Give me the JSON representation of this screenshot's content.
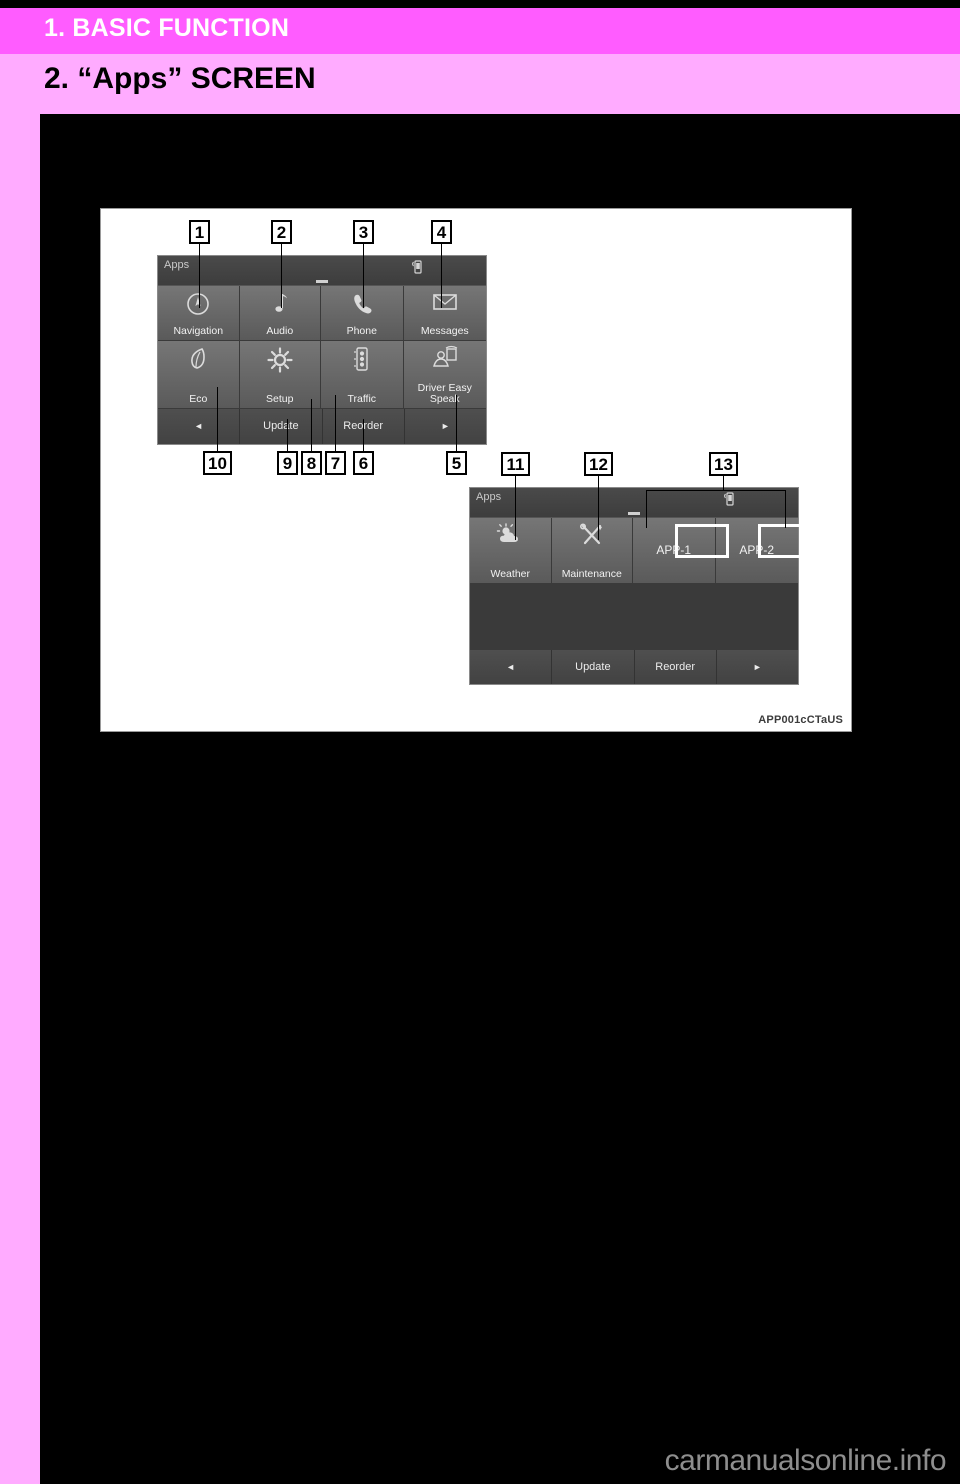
{
  "chapter": {
    "title": "1. BASIC FUNCTION"
  },
  "section": {
    "title": "2. “Apps” SCREEN"
  },
  "figure": {
    "code": "APP001cCTaUS",
    "screen1": {
      "titlebar": {
        "label": "Apps",
        "bluetooth_icon": "phone-signal-icon"
      },
      "tiles_row1": [
        {
          "label": "Navigation",
          "icon": "compass-icon"
        },
        {
          "label": "Audio",
          "icon": "music-note-icon"
        },
        {
          "label": "Phone",
          "icon": "handset-icon"
        },
        {
          "label": "Messages",
          "icon": "envelope-icon"
        }
      ],
      "tiles_row2": [
        {
          "label": "Eco",
          "icon": "leaf-icon"
        },
        {
          "label": "Setup",
          "icon": "gear-sun-icon"
        },
        {
          "label": "Traffic",
          "icon": "traffic-light-icon"
        },
        {
          "label": "Driver Easy Speak",
          "icon": "driver-speak-icon"
        }
      ],
      "bottom_bar": [
        {
          "label": "◄",
          "name": "prev-page-button"
        },
        {
          "label": "Update",
          "name": "update-button"
        },
        {
          "label": "Reorder",
          "name": "reorder-button"
        },
        {
          "label": "►",
          "name": "next-page-button"
        }
      ]
    },
    "screen2": {
      "titlebar": {
        "label": "Apps",
        "bluetooth_icon": "phone-signal-icon"
      },
      "tiles_row1": [
        {
          "label": "Weather",
          "icon": "sun-cloud-icon"
        },
        {
          "label": "Maintenance",
          "icon": "tools-icon"
        },
        {
          "label": "APP-1",
          "icon": "none"
        },
        {
          "label": "APP-2",
          "icon": "none"
        }
      ],
      "bottom_bar": [
        {
          "label": "◄",
          "name": "prev-page-button"
        },
        {
          "label": "Update",
          "name": "update-button"
        },
        {
          "label": "Reorder",
          "name": "reorder-button"
        },
        {
          "label": "►",
          "name": "next-page-button"
        }
      ]
    },
    "callouts": [
      {
        "n": "1"
      },
      {
        "n": "2"
      },
      {
        "n": "3"
      },
      {
        "n": "4"
      },
      {
        "n": "5"
      },
      {
        "n": "6"
      },
      {
        "n": "7"
      },
      {
        "n": "8"
      },
      {
        "n": "9"
      },
      {
        "n": "10"
      },
      {
        "n": "11"
      },
      {
        "n": "12"
      },
      {
        "n": "13"
      }
    ]
  },
  "footer": {
    "watermark": "carmanualsonline.info"
  },
  "colors": {
    "chapter_bar": "#ff5cff",
    "section_band": "#ffabff",
    "page_background": "#000000",
    "figure_background": "#ffffff",
    "screen_background": "#3a3a3a",
    "tile_top": "#767676",
    "tile_bottom": "#5a5a5a",
    "highlight": "#ffffff"
  }
}
